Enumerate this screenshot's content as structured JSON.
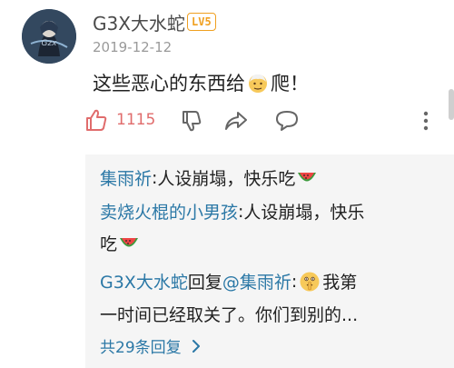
{
  "comment": {
    "username": "G3X大水蛇",
    "level": "LV5",
    "date": "2019-12-12",
    "text_before": "这些恶心的东西给",
    "text_after": "爬！",
    "emoji_icon": "old-person-emoji-icon",
    "likes": "1115"
  },
  "actions": {
    "like_icon": "thumbs-up-icon",
    "dislike_icon": "thumbs-down-icon",
    "share_icon": "share-icon",
    "reply_icon": "comment-bubble-icon",
    "more_icon": "more-vertical-icon"
  },
  "replies": [
    {
      "name": "集雨祈",
      "separator": ": ",
      "text": "人设崩塌，快乐吃",
      "emoji": "watermelon-icon"
    },
    {
      "name": "卖烧火棍的小男孩",
      "separator": ": ",
      "text_line1": "人设崩塌，快乐",
      "text_line2": "吃",
      "emoji": "watermelon-icon"
    },
    {
      "name": "G3X大水蛇",
      "middle": " 回复 ",
      "mention": "@集雨祈",
      "separator": ": ",
      "text_line1": "我第",
      "text_line2": "一时间已经取关了。你们到别的...",
      "emoji": "shushing-face-emoji-icon"
    }
  ],
  "view_all": "共29条回复",
  "colors": {
    "link_blue": "#2b78a6",
    "like_red": "#e06c6c",
    "badge_orange": "#f0a020",
    "reply_bg": "#f5f5f5"
  }
}
